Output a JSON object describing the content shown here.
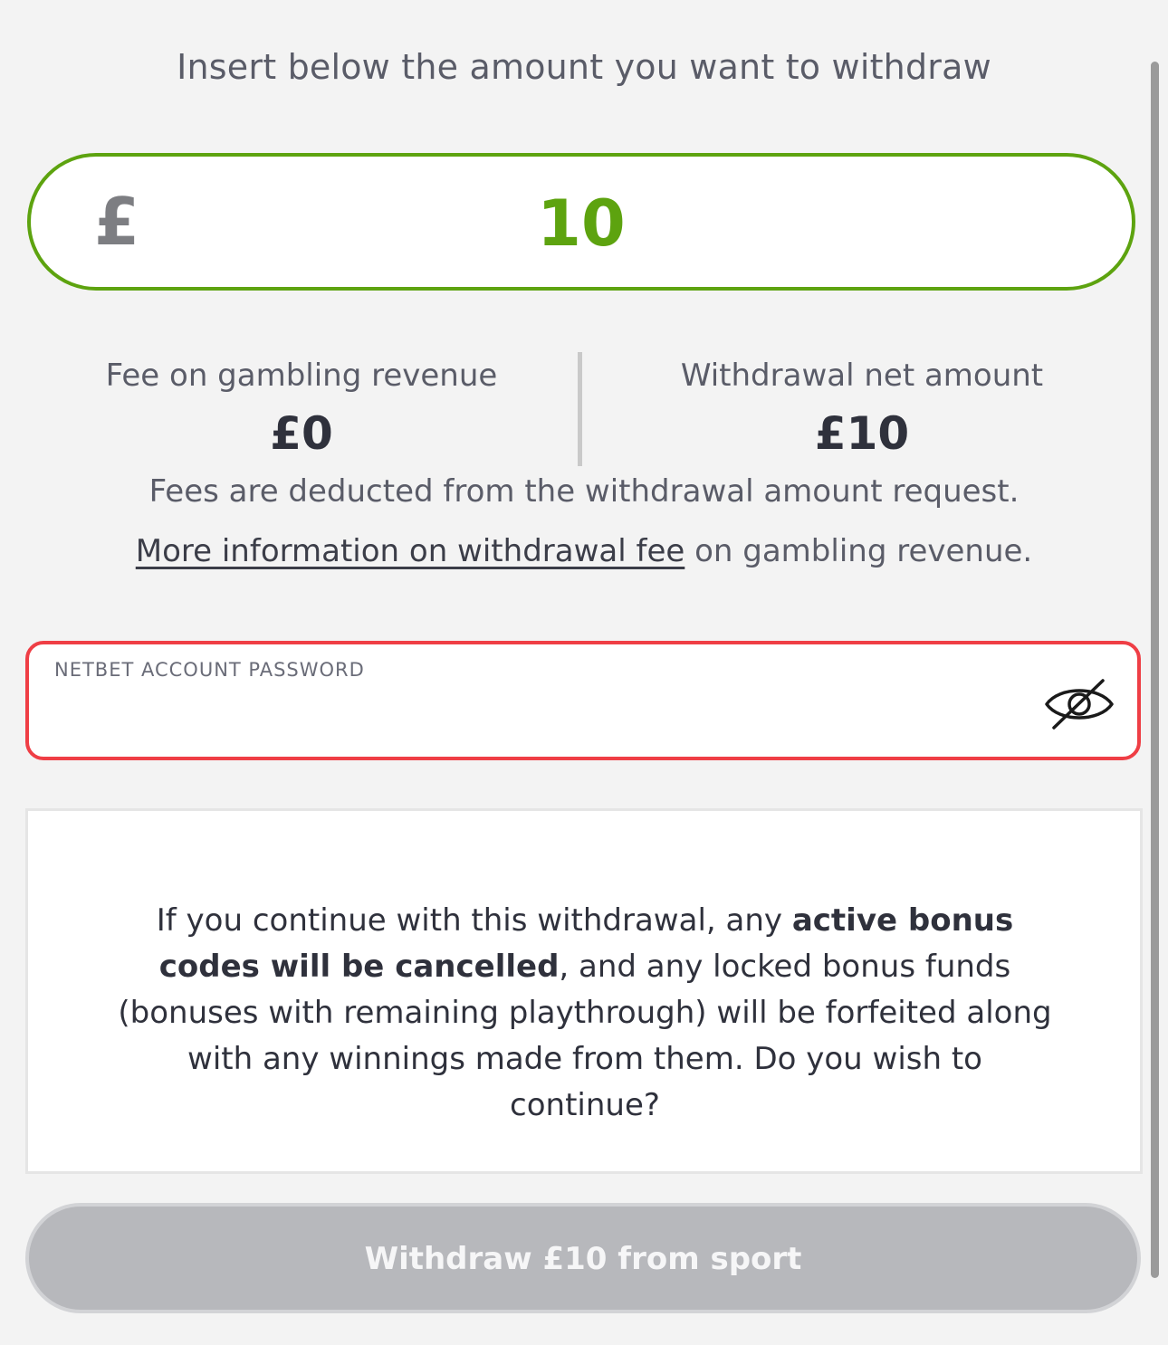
{
  "header": {
    "title": "Insert below the amount you want to withdraw"
  },
  "amount": {
    "currency_symbol": "£",
    "value": "10"
  },
  "fees": {
    "fee_label": "Fee on gambling revenue",
    "fee_value": "£0",
    "net_label": "Withdrawal net amount",
    "net_value": "£10",
    "note": "Fees are deducted from the withdrawal amount request.",
    "more_info_link": "More information on withdrawal fee",
    "more_info_suffix": " on gambling revenue."
  },
  "password": {
    "label": "NETBET ACCOUNT PASSWORD",
    "value": "",
    "toggle_icon": "eye-off-icon"
  },
  "warning": {
    "part1": "If you continue with this withdrawal, any ",
    "bold": "active bonus codes will be cancelled",
    "part2": ", and any locked bonus funds (bonuses with remaining playthrough) will be forfeited along with any winnings made from them. Do you wish to continue?"
  },
  "action": {
    "withdraw_label": "Withdraw £10 from sport"
  },
  "colors": {
    "accent_green": "#5da30f",
    "error_red": "#ef3e45",
    "disabled_button": "#b7b8bc"
  }
}
